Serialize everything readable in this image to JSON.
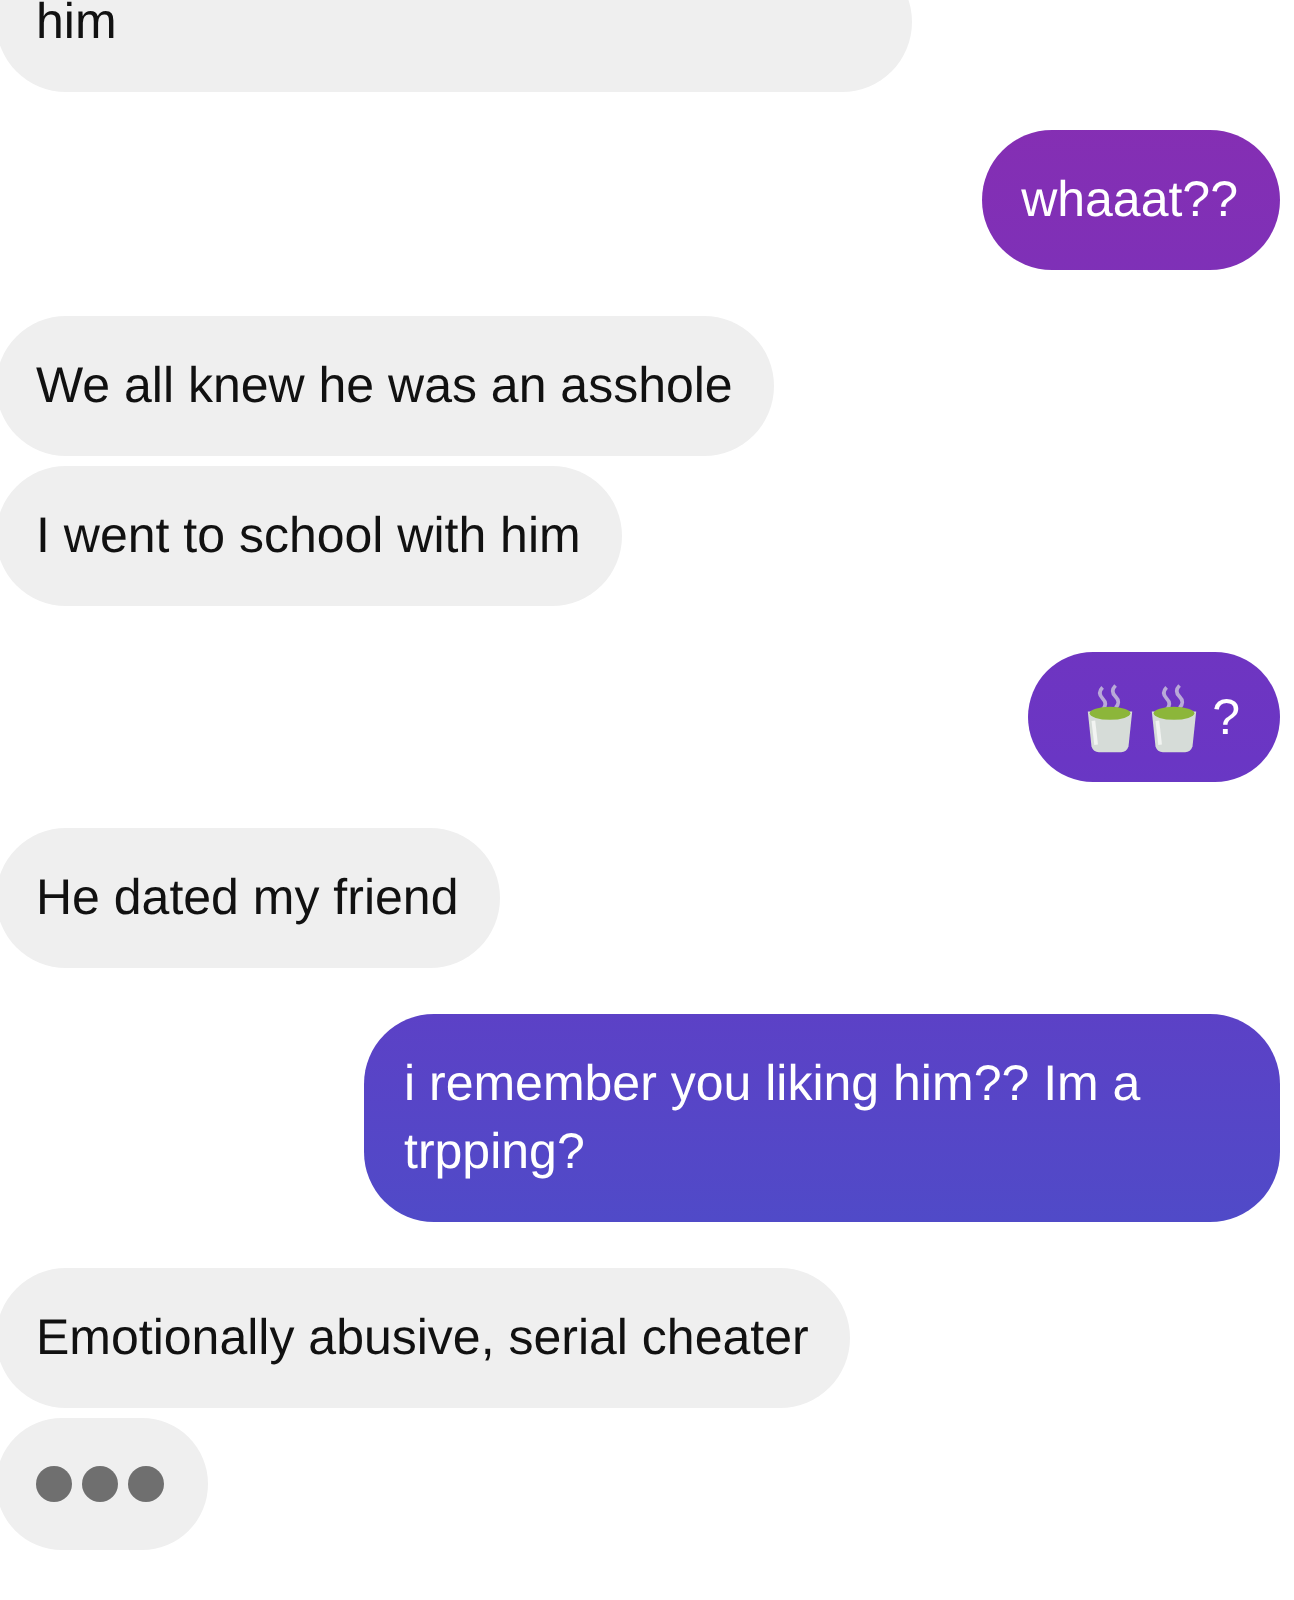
{
  "messages": [
    {
      "sent": false,
      "kind": "text",
      "text": "him"
    },
    {
      "sent": true,
      "kind": "text",
      "text": "whaaat??"
    },
    {
      "sent": false,
      "kind": "text",
      "text": "We all knew he was an asshole"
    },
    {
      "sent": false,
      "kind": "text",
      "text": "I went to school with him"
    },
    {
      "sent": true,
      "kind": "icons",
      "icons": [
        {
          "kind": "tea-cup"
        },
        {
          "kind": "tea-cup"
        }
      ],
      "text": "?"
    },
    {
      "sent": false,
      "kind": "text",
      "text": "He dated my friend"
    },
    {
      "sent": true,
      "kind": "text",
      "text": "i remember you liking him?? Im a trpping?"
    },
    {
      "sent": false,
      "kind": "text",
      "text": "Emotionally abusive, serial cheater"
    },
    {
      "sent": false,
      "kind": "typing"
    }
  ]
}
